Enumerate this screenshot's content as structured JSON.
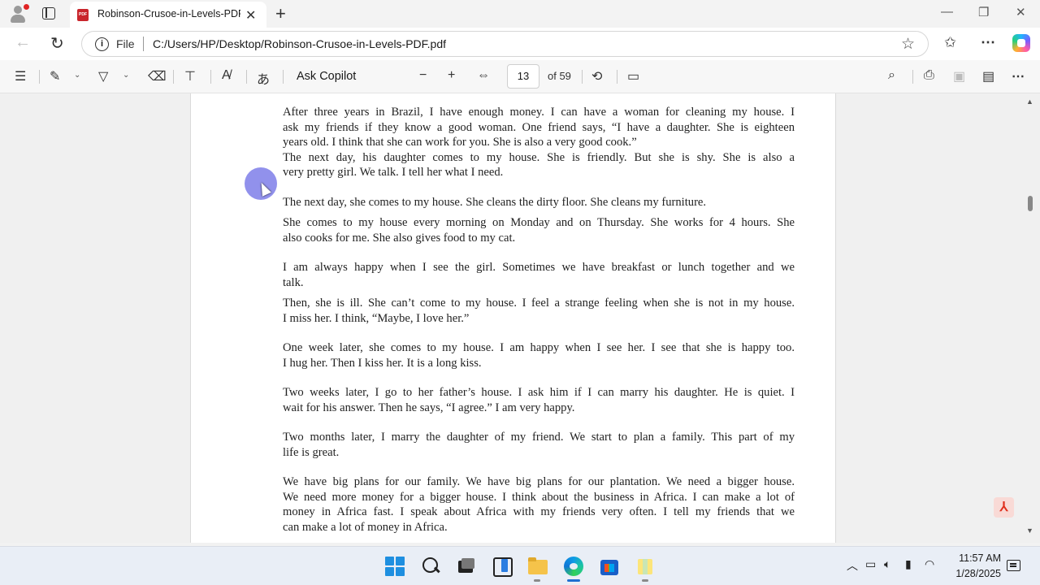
{
  "browser": {
    "tab_title": "Robinson-Crusoe-in-Levels-PDF.pdf",
    "scheme": "File",
    "url": "C:/Users/HP/Desktop/Robinson-Crusoe-in-Levels-PDF.pdf"
  },
  "pdf_toolbar": {
    "ask_copilot": "Ask Copilot",
    "current_page": "13",
    "page_count": "of 59"
  },
  "document": {
    "paragraphs": [
      {
        "lines": [
          "After three years in Brazil, I have enough money. I can have a woman for cleaning my house. I",
          "ask my friends if they know a good woman. One friend says, “I have a daughter. She is eighteen",
          "years old. I think that she can work for you. She is also a very good cook.”"
        ]
      },
      {
        "lines": [
          "The next day, his daughter comes to my house. She is friendly. But she is shy. She is also a",
          "very pretty girl. We talk. I tell her what I need."
        ]
      },
      {
        "lines": [
          "The next day, she comes to my house. She cleans the dirty floor. She cleans my furniture."
        ]
      },
      {
        "lines": [
          "She comes to my house every morning on Monday and on Thursday. She works for 4 hours. She",
          "also cooks for me. She also gives food to my cat."
        ]
      },
      {
        "lines": [
          "I am always happy when I see the girl. Sometimes we have breakfast or lunch together and we",
          "talk."
        ]
      },
      {
        "lines": [
          "Then, she is ill. She can’t come to my house. I feel a strange feeling when she is not in my house.",
          "I miss her. I think, “Maybe, I love her.”"
        ]
      },
      {
        "lines": [
          "One week later, she comes to my house. I am happy when I see her. I see that she is happy too.",
          "I hug her. Then I kiss her. It is a long kiss."
        ]
      },
      {
        "lines": [
          "Two weeks later, I go to her father’s house. I ask him if I can marry his daughter. He is quiet. I",
          "wait for his answer. Then he says, “I agree.” I am very happy."
        ]
      },
      {
        "lines": [
          "Two months later, I marry the daughter of my friend. We start to plan a family. This part of my",
          "life is great."
        ]
      },
      {
        "lines": [
          "We have big plans for our family. We have big plans for our plantation. We need a bigger house.",
          "We need more money for a bigger house. I think about the business in Africa. I can make a lot of",
          "money in Africa fast. I speak about Africa with my friends very often. I tell my friends that we",
          "can make a lot of money in Africa."
        ]
      }
    ]
  },
  "taskbar": {
    "time": "11:57 AM",
    "date": "1/28/2025"
  },
  "icons": [
    "profile-icon",
    "tab-actions-icon",
    "pdf-icon",
    "close-icon",
    "new-tab-icon",
    "minimize-icon",
    "restore-icon",
    "window-close-icon",
    "back-icon",
    "refresh-icon",
    "info-icon",
    "favorite-star-icon",
    "favorites-icon",
    "more-icon",
    "copilot-icon",
    "contents-icon",
    "highlight-icon",
    "draw-icon",
    "erase-icon",
    "text-icon",
    "read-aloud-icon",
    "translate-icon",
    "zoom-out-icon",
    "zoom-in-icon",
    "fit-width-icon",
    "rotate-icon",
    "page-view-icon",
    "search-icon",
    "print-icon",
    "save-icon",
    "save-as-icon",
    "windows-start-icon",
    "taskbar-search-icon",
    "task-view-icon",
    "widgets-icon",
    "file-explorer-icon",
    "edge-icon",
    "store-icon",
    "sticky-notes-icon",
    "chevron-up-icon",
    "battery-icon",
    "volume-icon",
    "microphone-icon",
    "wifi-icon",
    "notification-icon",
    "acrobat-icon"
  ]
}
